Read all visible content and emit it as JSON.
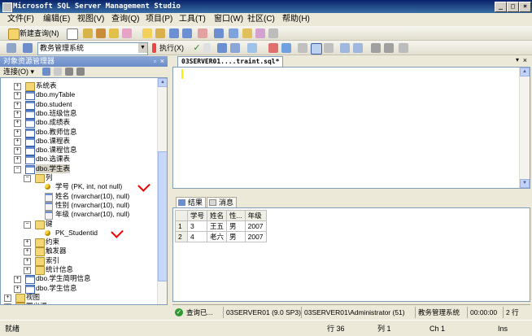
{
  "window": {
    "title": "Microsoft SQL Server Management Studio"
  },
  "titlebar_buttons": [
    "_",
    "□",
    "×"
  ],
  "menu": [
    "文件(F)",
    "编辑(E)",
    "视图(V)",
    "查询(Q)",
    "项目(P)",
    "工具(T)",
    "窗口(W)",
    "社区(C)",
    "帮助(H)"
  ],
  "toolbar": {
    "new_query": "新建查询(N)",
    "database": "教务管理系统",
    "execute": "执行(X)"
  },
  "object_explorer": {
    "title": "对象资源管理器",
    "connect": "连接(O) ▾",
    "nodes": [
      {
        "label": "系统表",
        "icon": "folder",
        "exp": "+"
      },
      {
        "label": "dbo.myTable",
        "icon": "table",
        "exp": "+"
      },
      {
        "label": "dbo.student",
        "icon": "table",
        "exp": "+"
      },
      {
        "label": "dbo.班级信息",
        "icon": "table",
        "exp": "+"
      },
      {
        "label": "dbo.成绩表",
        "icon": "table",
        "exp": "+"
      },
      {
        "label": "dbo.教师信息",
        "icon": "table",
        "exp": "+"
      },
      {
        "label": "dbo.课程表",
        "icon": "table",
        "exp": "+"
      },
      {
        "label": "dbo.课程信息",
        "icon": "table",
        "exp": "+"
      },
      {
        "label": "dbo.选课表",
        "icon": "table",
        "exp": "+"
      },
      {
        "label": "dbo.学生表",
        "icon": "table",
        "exp": "−"
      },
      {
        "label": "列",
        "icon": "folder",
        "exp": "−"
      },
      {
        "label": "学号 (PK, int, not null)",
        "icon": "key",
        "exp": ""
      },
      {
        "label": "姓名 (nvarchar(10), null)",
        "icon": "col",
        "exp": ""
      },
      {
        "label": "性别 (nvarchar(10), null)",
        "icon": "col",
        "exp": ""
      },
      {
        "label": "年级 (nvarchar(10), null)",
        "icon": "col",
        "exp": ""
      },
      {
        "label": "键",
        "icon": "folder",
        "exp": "−"
      },
      {
        "label": "PK_Studentid",
        "icon": "key",
        "exp": ""
      },
      {
        "label": "约束",
        "icon": "folder",
        "exp": "+"
      },
      {
        "label": "触发器",
        "icon": "folder",
        "exp": "+"
      },
      {
        "label": "索引",
        "icon": "folder",
        "exp": "+"
      },
      {
        "label": "统计信息",
        "icon": "folder",
        "exp": "+"
      },
      {
        "label": "dbo.学生简明信息",
        "icon": "table",
        "exp": "+"
      },
      {
        "label": "dbo.学生信息",
        "icon": "table",
        "exp": "+"
      },
      {
        "label": "视图",
        "icon": "folder",
        "exp": "+"
      },
      {
        "label": "同义词",
        "icon": "folder",
        "exp": "+"
      }
    ]
  },
  "editor": {
    "tab_label": "03SERVER01....traint.sql*"
  },
  "results": {
    "tab_results": "结果",
    "tab_messages": "消息",
    "columns": [
      "学号",
      "姓名",
      "性...",
      "年级"
    ],
    "rows": [
      {
        "n": "1",
        "cells": [
          "3",
          "王五",
          "男",
          "2007"
        ]
      },
      {
        "n": "2",
        "cells": [
          "4",
          "老六",
          "男",
          "2007"
        ]
      }
    ]
  },
  "query_status": {
    "state": "查询已...",
    "server": "03SERVER01 (9.0 SP3)",
    "user": "03SERVER01\\Administrator (51)",
    "db": "教务管理系统",
    "time": "00:00:00",
    "rows": "2 行"
  },
  "statusbar": {
    "ready": "就绪",
    "line": "行 36",
    "col": "列 1",
    "ch": "Ch 1",
    "mode": "Ins"
  }
}
